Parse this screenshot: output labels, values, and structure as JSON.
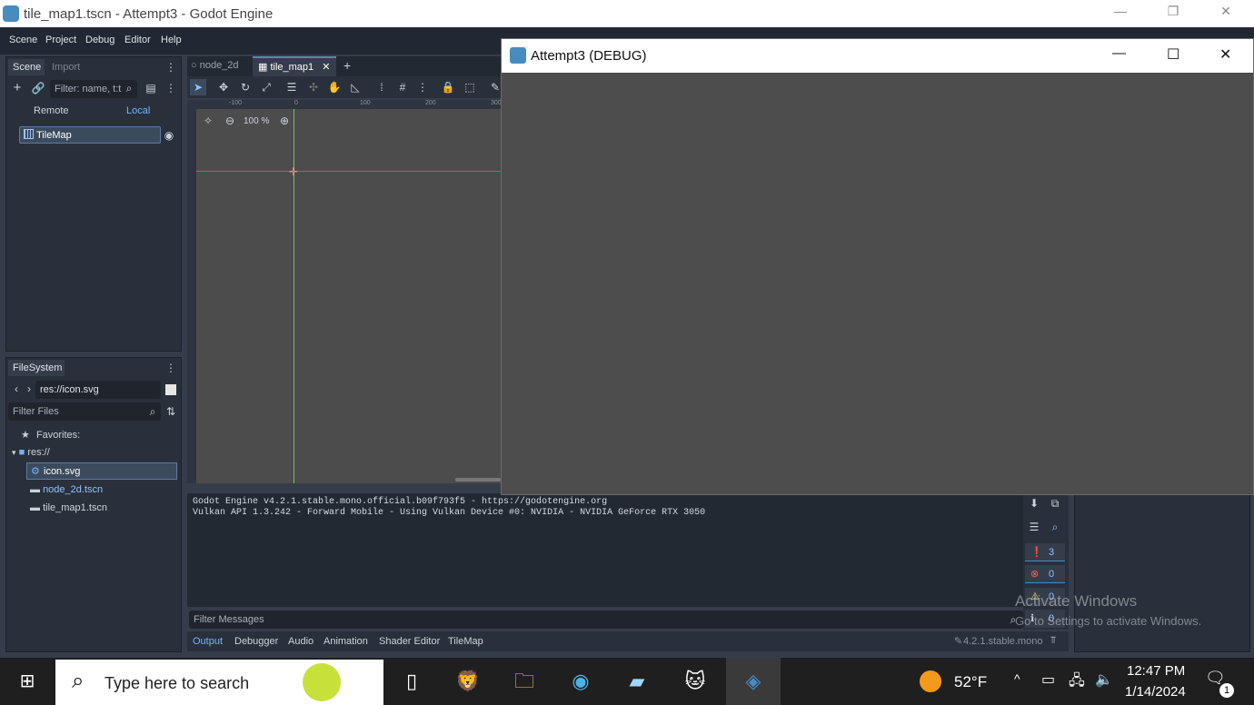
{
  "window": {
    "title": "tile_map1.tscn - Attempt3 - Godot Engine",
    "controls": [
      "—",
      "❐",
      "✕"
    ]
  },
  "menu": [
    "Scene",
    "Project",
    "Debug",
    "Editor",
    "Help"
  ],
  "scene_dock": {
    "tabs": [
      "Scene",
      "Import"
    ],
    "filter_placeholder": "Filter: name, t:t",
    "remote_label": "Remote",
    "local_label": "Local",
    "root_node": "TileMap"
  },
  "editor_tabs": [
    "node_2d",
    "tile_map1"
  ],
  "viewport": {
    "zoom": "100 %",
    "ruler_labels": [
      "-100",
      "0",
      "100",
      "200",
      "300"
    ]
  },
  "filesystem": {
    "tab": "FileSystem",
    "path": "res://icon.svg",
    "filter_placeholder": "Filter Files",
    "favorites_label": "Favorites:",
    "root": "res://",
    "files": [
      "icon.svg",
      "node_2d.tscn",
      "tile_map1.tscn"
    ]
  },
  "debug_window": {
    "title": "Attempt3 (DEBUG)",
    "controls": [
      "—",
      "☐",
      "✕"
    ]
  },
  "output": {
    "lines": [
      "Godot Engine v4.2.1.stable.mono.official.b09f793f5 - https://godotengine.org",
      "Vulkan API 1.3.242 - Forward Mobile - Using Vulkan Device #0: NVIDIA - NVIDIA GeForce RTX 3050"
    ],
    "filter_placeholder": "Filter Messages",
    "counts": {
      "messages": "3",
      "errors": "0",
      "warnings": "0",
      "info": "0"
    }
  },
  "bottom_tabs": [
    "Output",
    "Debugger",
    "Audio",
    "Animation",
    "Shader Editor",
    "TileMap"
  ],
  "version": "4.2.1.stable.mono",
  "watermark": {
    "title": "Activate Windows",
    "subtitle": "Go to Settings to activate Windows."
  },
  "taskbar": {
    "search_placeholder": "Type here to search",
    "weather": "52°F",
    "time": "12:47 PM",
    "date": "1/14/2024",
    "notification_count": "1"
  },
  "colors": {
    "accent": "#478cbf",
    "editor_bg": "#2a303b",
    "viewport_bg": "#4c4c4c"
  }
}
